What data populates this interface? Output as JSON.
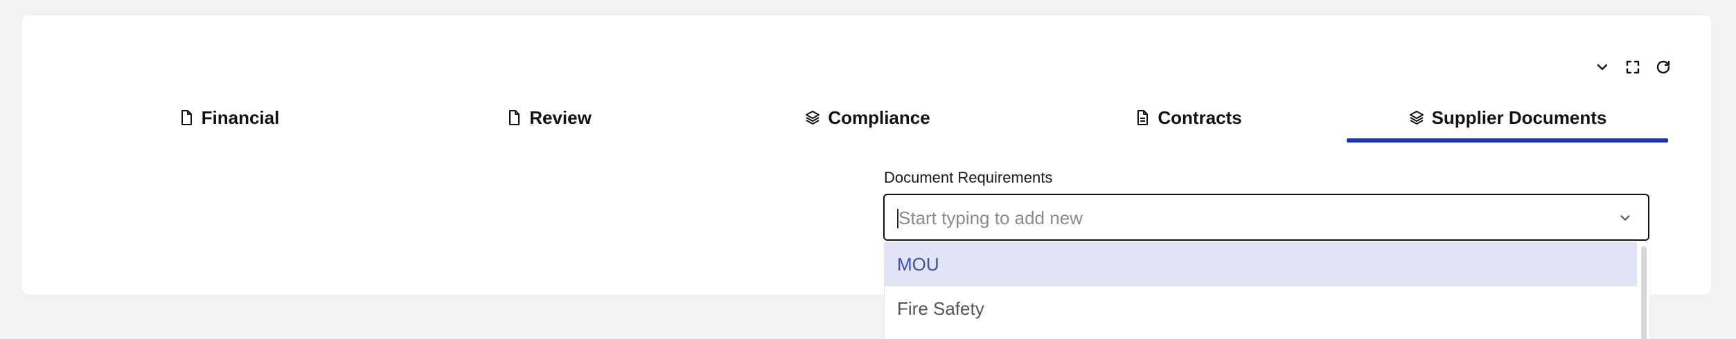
{
  "toolbar": {
    "collapse_icon": "chevron-down-icon",
    "fullscreen_icon": "expand-icon",
    "refresh_icon": "refresh-icon"
  },
  "tabs": [
    {
      "label": "Financial",
      "icon": "file-icon",
      "active": false
    },
    {
      "label": "Review",
      "icon": "file-icon",
      "active": false
    },
    {
      "label": "Compliance",
      "icon": "layers-icon",
      "active": false
    },
    {
      "label": "Contracts",
      "icon": "file-text-icon",
      "active": false
    },
    {
      "label": "Supplier Documents",
      "icon": "layers-icon",
      "active": true
    }
  ],
  "document_requirements": {
    "label": "Document Requirements",
    "placeholder": "Start typing to add new",
    "value": "",
    "options": [
      {
        "label": "MOU",
        "highlighted": true
      },
      {
        "label": "Fire Safety",
        "highlighted": false
      }
    ]
  },
  "colors": {
    "accent": "#1c35b8",
    "highlight_bg": "#e1e5f6",
    "highlight_text": "#3b4fb8",
    "page_bg": "#f2f2f2"
  }
}
